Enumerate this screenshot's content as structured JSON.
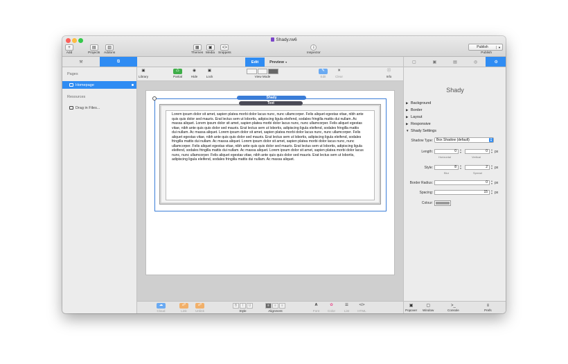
{
  "window": {
    "title": "Shady.rw6",
    "traffic_colors": [
      "#fc605b",
      "#fdbc40",
      "#34c84a"
    ]
  },
  "toolbar": {
    "left": [
      {
        "label": "Add",
        "glyph": "+",
        "icon": "plus-icon"
      }
    ],
    "left2": [
      {
        "label": "Projects",
        "glyph": "▤",
        "icon": "projects-icon"
      },
      {
        "label": "Addons",
        "glyph": "▥",
        "icon": "addons-icon"
      }
    ],
    "middle": [
      {
        "label": "Themes",
        "glyph": "▦",
        "icon": "themes-icon"
      },
      {
        "label": "Media",
        "glyph": "▣",
        "icon": "media-icon"
      },
      {
        "label": "Snippets",
        "glyph": "<>",
        "icon": "snippets-icon"
      }
    ],
    "inspector": {
      "label": "Inspector",
      "glyph": "i",
      "icon": "info-icon"
    },
    "publish": {
      "label": "Publish",
      "caption": "Publish"
    }
  },
  "sidebar": {
    "tabs": [
      {
        "glyph": "⚒",
        "icon": "wrench-icon"
      },
      {
        "glyph": "⧉",
        "icon": "pages-icon"
      }
    ],
    "pages_heading": "Pages",
    "pages": [
      {
        "label": "Homepage"
      }
    ],
    "resources_heading": "Resources",
    "resources": [
      {
        "label": "Drag in Files..."
      }
    ]
  },
  "center": {
    "tabs": {
      "edit": "Edit",
      "preview": "Preview"
    },
    "tools": {
      "library": "Library",
      "partial": "Partial",
      "hide": "Hide",
      "lock": "Lock",
      "view_mode": "View Mode",
      "edit": "Edit",
      "clear": "Clear",
      "info": "Info"
    },
    "shady_label": "Shady",
    "text_label": "Text",
    "lorem": "Lorem ipsum dolor sit amet, sapien platea morbi dolor lacus nunc, nunc ullamcorper. Felis aliquet egestas vitae, nibh ante quis quis dolor sed mauris. Erat lectus sem ut lobortis, adipiscing ligula eleifend, sodales fringilla mattis dui nullam. Ac massa aliquet. Lorem ipsum dolor sit amet, sapien platea morbi dolor lacus nunc, nunc ullamcorper. Felis aliquet egestas vitae, nibh ante quis quis dolor sed mauris. Erat lectus sem ut lobortis, adipiscing ligula eleifend, sodales fringilla mattis dui nullam. Ac massa aliquet. Lorem ipsum dolor sit amet, sapien platea morbi dolor lacus nunc, nunc ullamcorper. Felis aliquet egestas vitae, nibh ante quis quis dolor sed mauris. Erat lectus sem ut lobortis, adipiscing ligula eleifend, sodales fringilla mattis dui nullam. Ac massa aliquet. Lorem ipsum dolor sit amet, sapien platea morbi dolor lacus nunc, nunc ullamcorper. Felis aliquet egestas vitae, nibh ante quis quis dolor sed mauris. Erat lectus sem ut lobortis, adipiscing ligula eleifend, sodales fringilla mattis dui nullam. Ac massa aliquet. Lorem ipsum dolor sit amet, sapien platea morbi dolor lacus nunc, nunc ullamcorper. Felis aliquet egestas vitae, nibh ante quis quis dolor sed mauris. Erat lectus sem ut lobortis, adipiscing ligula eleifend, sodales fringilla mattis dui nullam. Ac massa aliquet.",
    "bottom": {
      "cloud": "Cloud",
      "link": "Link",
      "unlink": "Unlink",
      "style": "Style",
      "alignment": "Alignment",
      "font": "Font",
      "color": "Color",
      "list": "List",
      "html": "HTML"
    }
  },
  "inspector": {
    "title": "Shady",
    "sections": [
      "Background",
      "Border",
      "Layout",
      "Responsive",
      "Shady Settings"
    ],
    "shadow_type_label": "Shadow Type:",
    "shadow_type_value": "Box Shadow (default)",
    "length_label": "Length:",
    "length_h": "0",
    "length_v": "0",
    "horizontal": "Horizontal",
    "vertical": "Vertical",
    "style_label": "Style:",
    "blur_value": "8",
    "spread_value": "2",
    "blur": "Blur",
    "spread": "Spread",
    "radius_label": "Border Radius:",
    "radius_value": "0",
    "spacing_label": "Spacing:",
    "spacing_value": "15",
    "colour_label": "Colour:",
    "unit": "px",
    "bottom": {
      "popover": "Popover",
      "window": "Window",
      "console": "Console",
      "prefs": "Prefs"
    },
    "swatch_color": "#9a9a9a"
  },
  "accent": "#2f8cf3"
}
